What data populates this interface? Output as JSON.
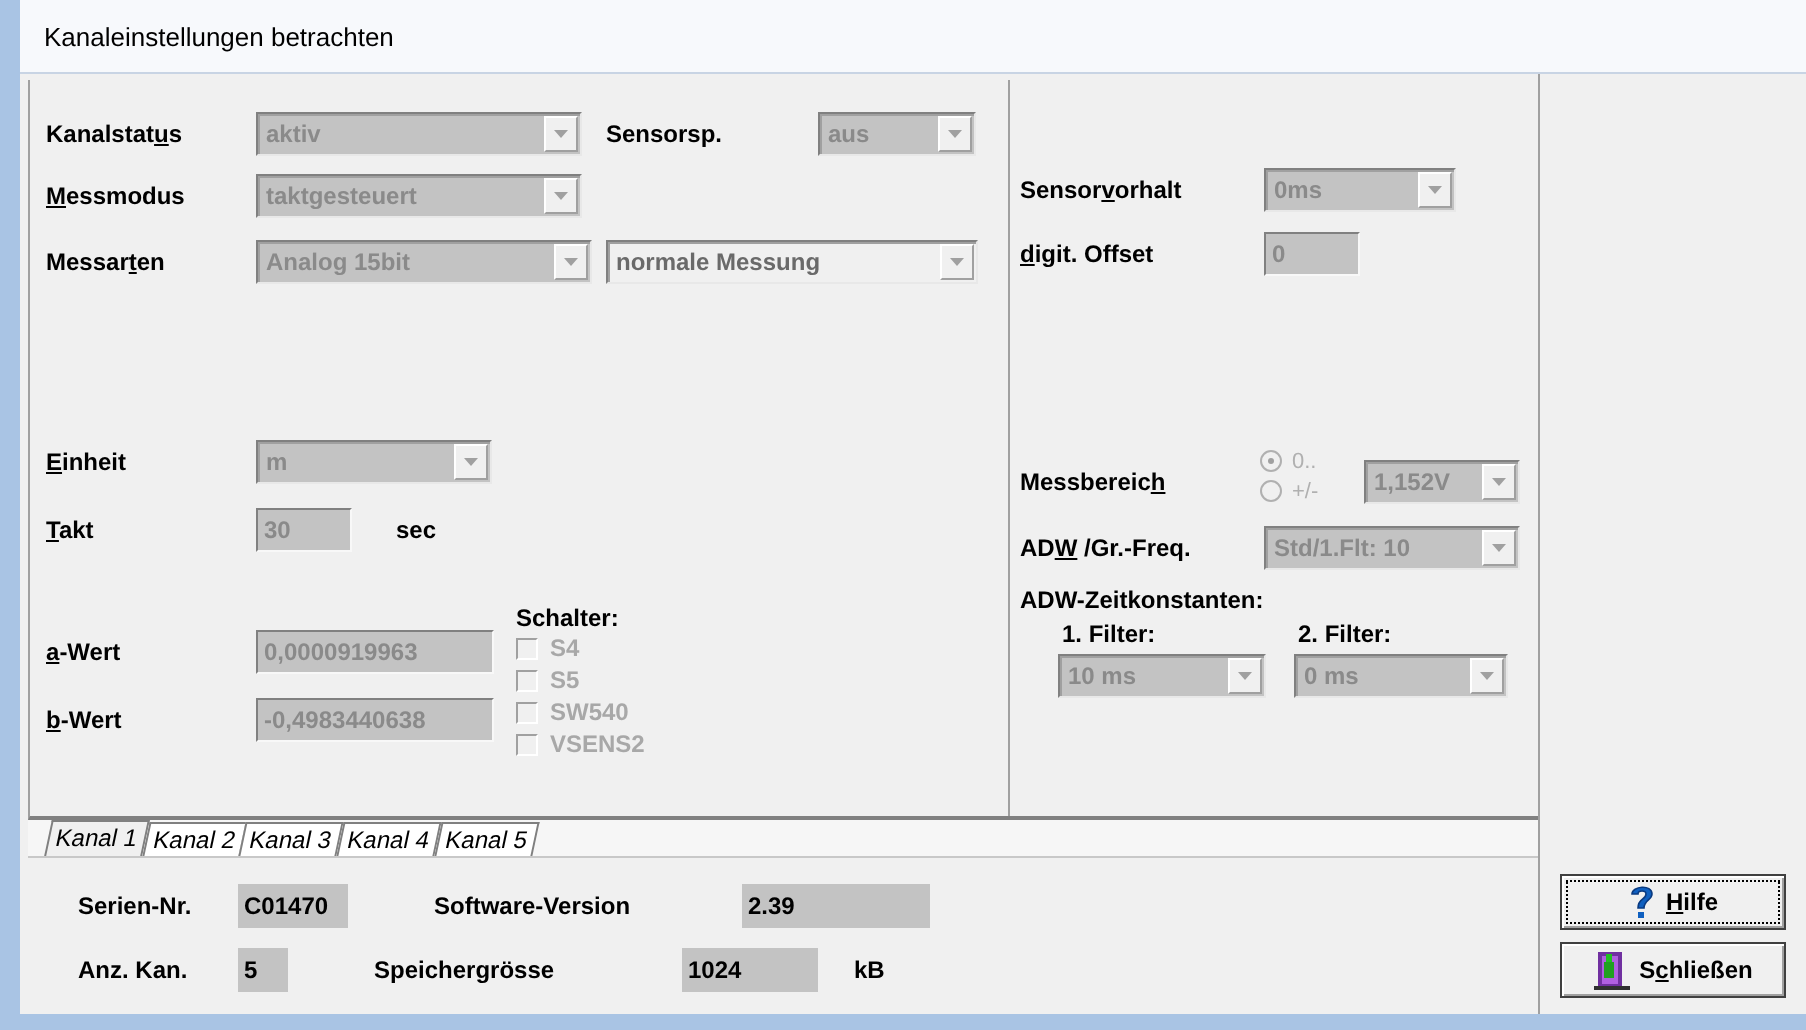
{
  "window": {
    "title": "Kanaleinstellungen betrachten"
  },
  "channel": {
    "kanalstatus": {
      "label": {
        "pre": "Kanalstat",
        "key": "u",
        "post": "s"
      },
      "value": "aktiv",
      "disabled": true
    },
    "sensorsp": {
      "label": "Sensorsp.",
      "value": "aus",
      "disabled": true
    },
    "messmodus": {
      "label": {
        "key": "M",
        "post": "essmodus"
      },
      "value": "taktgesteuert",
      "disabled": true
    },
    "messarten": {
      "label": {
        "pre": "Messar",
        "key": "t",
        "post": "en"
      },
      "value": "Analog 15bit",
      "disabled": true
    },
    "messung": {
      "value": "normale Messung",
      "disabled": false
    },
    "einheit": {
      "label": {
        "key": "E",
        "post": "inheit"
      },
      "value": "m",
      "disabled": true
    },
    "takt": {
      "label": {
        "key": "T",
        "post": "akt"
      },
      "value": "30",
      "unit": "sec"
    },
    "a_wert": {
      "label": {
        "key": "a",
        "post": "-Wert"
      },
      "value": "0,0000919963"
    },
    "b_wert": {
      "label": {
        "key": "b",
        "post": "-Wert"
      },
      "value": "-0,4983440638"
    },
    "schalter": {
      "title": "Schalter:",
      "items": [
        {
          "label": "S4",
          "checked": false
        },
        {
          "label": "S5",
          "checked": false
        },
        {
          "label": "SW540",
          "checked": false
        },
        {
          "label": "VSENS2",
          "checked": false
        }
      ]
    },
    "sensorvorhalt": {
      "label": {
        "pre": "Sensor",
        "key": "v",
        "post": "orhalt"
      },
      "value": "0ms",
      "disabled": true
    },
    "offset": {
      "label": {
        "key": "d",
        "post": "igit. Offset"
      },
      "value": "0"
    },
    "messbereich": {
      "label": {
        "pre": "Messbereic",
        "key": "h"
      },
      "ranges": [
        {
          "label": "0..",
          "selected": true
        },
        {
          "label": "+/-",
          "selected": false
        }
      ],
      "value": "1,152V",
      "disabled": true
    },
    "adw": {
      "label": {
        "pre": "AD",
        "key": "W",
        "post": " /Gr.-Freq."
      },
      "value": "Std/1.Flt: 10",
      "disabled": true
    },
    "zeitkonstanten": {
      "title": "ADW-Zeitkonstanten:",
      "filters": [
        {
          "label": "1. Filter:",
          "value": "10 ms",
          "disabled": true
        },
        {
          "label": "2. Filter:",
          "value": "0 ms",
          "disabled": true
        }
      ]
    }
  },
  "tabs": [
    {
      "label": "Kanal 1",
      "selected": true
    },
    {
      "label": "Kanal 2",
      "selected": false
    },
    {
      "label": "Kanal 3",
      "selected": false
    },
    {
      "label": "Kanal 4",
      "selected": false
    },
    {
      "label": "Kanal 5",
      "selected": false
    }
  ],
  "info": {
    "serial": {
      "label": "Serien-Nr.",
      "value": "C01470"
    },
    "software": {
      "label": "Software-Version",
      "value": "2.39"
    },
    "count": {
      "label": "Anz. Kan.",
      "value": "5"
    },
    "memory": {
      "label": "Speichergrösse",
      "value": "1024",
      "unit": "kB"
    }
  },
  "buttons": [
    {
      "kind": "help",
      "label": {
        "key": "H",
        "post": "ilfe"
      }
    },
    {
      "kind": "close",
      "label": {
        "pre": "S",
        "key": "c",
        "post": "hließen"
      }
    }
  ]
}
